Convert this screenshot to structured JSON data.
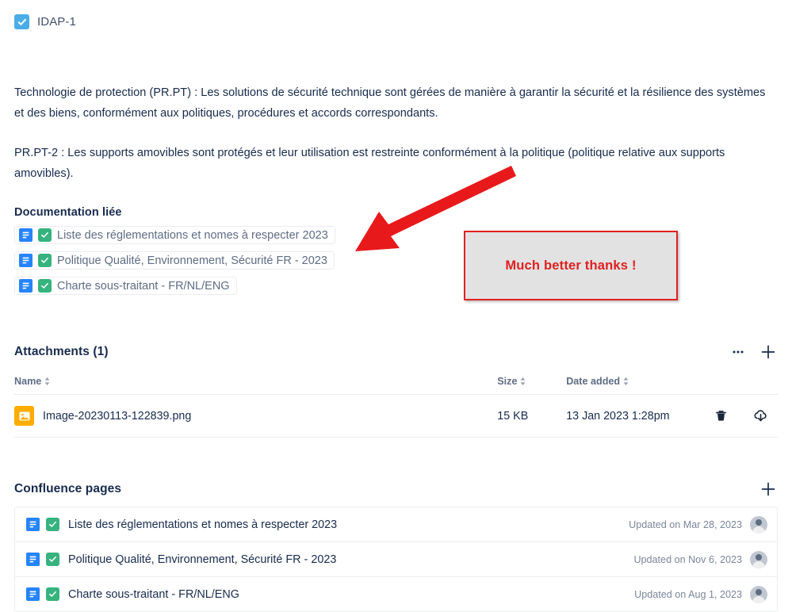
{
  "issue": {
    "key_label": "IDAP-1",
    "checkbox_checked": true,
    "checkbox_color": "#4BADE8"
  },
  "description": {
    "paragraph_1": "Technologie de protection (PR.PT) : Les solutions de sécurité technique sont gérées de manière à garantir la sécurité et la résilience des systèmes et des biens, conformément aux politiques, procédures et accords correspondants.",
    "paragraph_2": "PR.PT-2 : Les supports amovibles sont protégés et leur utilisation est restreinte conformément à la politique (politique relative aux supports amovibles)."
  },
  "linked_documentation": {
    "title": "Documentation liée",
    "links": [
      {
        "label": "Liste des réglementations et nomes à respecter 2023",
        "page_icon": "confluence-page-icon",
        "status_icon": "green-check-icon"
      },
      {
        "label": "Politique Qualité, Environnement, Sécurité FR - 2023",
        "page_icon": "confluence-page-icon",
        "status_icon": "green-check-icon"
      },
      {
        "label": "Charte sous-traitant - FR/NL/ENG",
        "page_icon": "confluence-page-icon",
        "status_icon": "green-check-icon"
      }
    ]
  },
  "annotation": {
    "callout_text": "Much better thanks !",
    "accent_color": "#E02020",
    "box_fill": "#E2E2E2",
    "arrow_icon": "red-arrow-icon"
  },
  "attachments": {
    "title": "Attachments (1)",
    "more_icon": "ellipsis-icon",
    "add_icon": "plus-icon",
    "columns": [
      {
        "label": "Name",
        "sortable": true
      },
      {
        "label": "Size",
        "sortable": true
      },
      {
        "label": "Date added",
        "sortable": true
      }
    ],
    "rows": [
      {
        "file_icon": "image-file-icon",
        "name": "Image-20230113-122839.png",
        "size": "15 KB",
        "date_added": "13 Jan 2023 1:28pm",
        "delete_icon": "trash-icon",
        "download_icon": "cloud-download-icon"
      }
    ]
  },
  "confluence_pages": {
    "title": "Confluence pages",
    "add_icon": "plus-icon",
    "rows": [
      {
        "page_icon": "confluence-page-icon",
        "status_icon": "green-check-icon",
        "label": "Liste des réglementations et nomes à respecter 2023",
        "updated": "Updated on Mar 28, 2023",
        "avatar": "user-avatar"
      },
      {
        "page_icon": "confluence-page-icon",
        "status_icon": "green-check-icon",
        "label": "Politique Qualité, Environnement, Sécurité FR - 2023",
        "updated": "Updated on Nov 6, 2023",
        "avatar": "user-avatar"
      },
      {
        "page_icon": "confluence-page-icon",
        "status_icon": "green-check-icon",
        "label": "Charte sous-traitant - FR/NL/ENG",
        "updated": "Updated on Aug 1, 2023",
        "avatar": "user-avatar"
      }
    ]
  }
}
